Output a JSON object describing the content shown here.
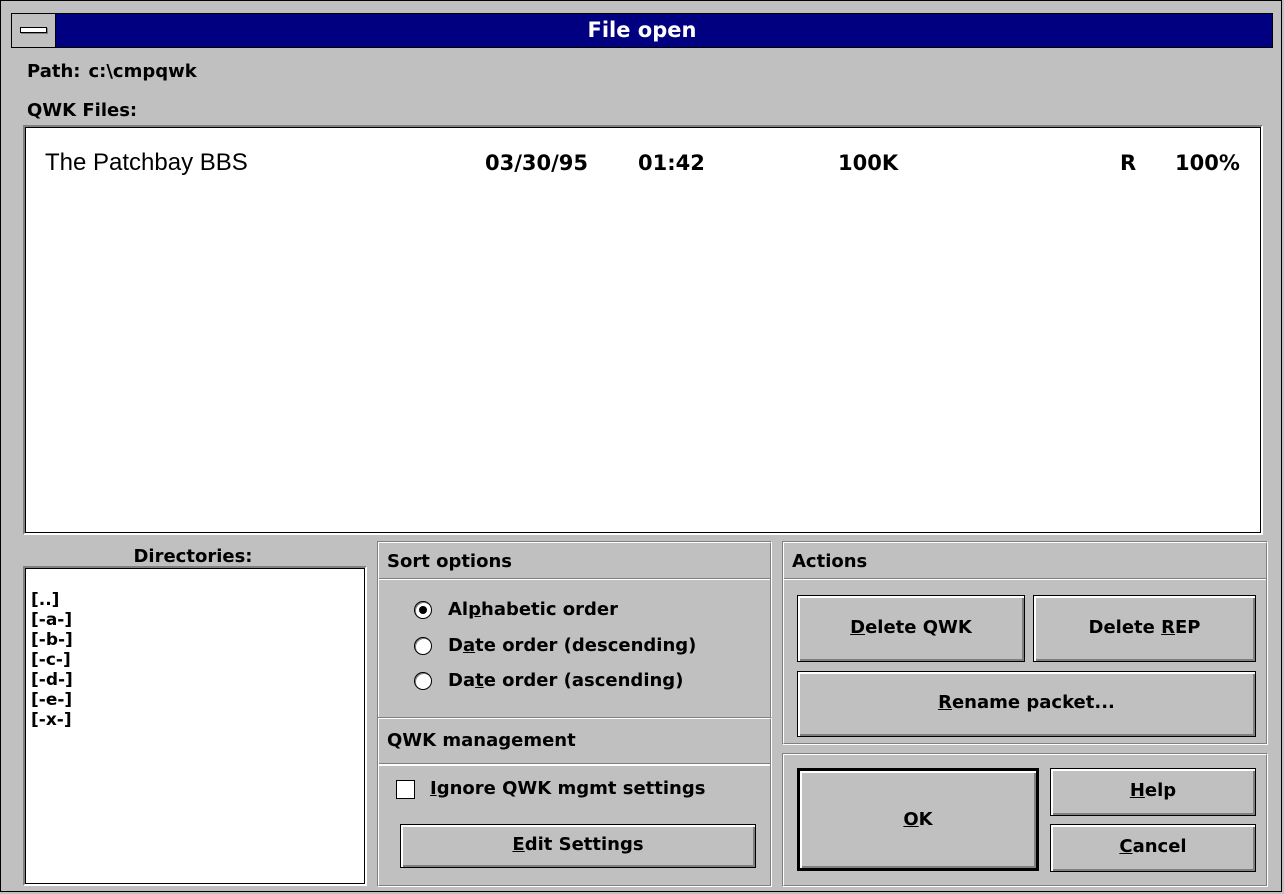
{
  "window": {
    "title": "File open"
  },
  "path": {
    "label": "Path:",
    "value": "c:\\cmpqwk"
  },
  "qwk_files": {
    "label": "QWK Files:",
    "rows": [
      {
        "name": "The Patchbay BBS",
        "date": "03/30/95",
        "time": "01:42",
        "size": "100K",
        "flag": "R",
        "percent": "100%"
      }
    ]
  },
  "directories": {
    "label": "Directories:",
    "items": [
      "[..]",
      "[-a-]",
      "[-b-]",
      "[-c-]",
      "[-d-]",
      "[-e-]",
      "[-x-]"
    ]
  },
  "sort_options": {
    "title": "Sort options",
    "options": [
      {
        "pre": "Al",
        "mn": "p",
        "post": "habetic order",
        "selected": true
      },
      {
        "pre": "D",
        "mn": "a",
        "post": "te order (descending)",
        "selected": false
      },
      {
        "pre": "Da",
        "mn": "t",
        "post": "e order (ascending)",
        "selected": false
      }
    ]
  },
  "qwk_management": {
    "title": "QWK management",
    "ignore": {
      "mn": "I",
      "post": "gnore QWK mgmt settings",
      "checked": false
    },
    "edit_button": {
      "mn": "E",
      "post": "dit Settings"
    }
  },
  "actions": {
    "title": "Actions",
    "delete_qwk": {
      "mn": "D",
      "post": "elete QWK"
    },
    "delete_rep": {
      "pre": "Delete ",
      "mn": "R",
      "post": "EP"
    },
    "rename": {
      "mn": "R",
      "post": "ename packet..."
    }
  },
  "dialog_buttons": {
    "ok": {
      "mn": "O",
      "post": "K"
    },
    "help": {
      "mn": "H",
      "post": "elp"
    },
    "cancel": {
      "mn": "C",
      "post": "ancel"
    }
  }
}
